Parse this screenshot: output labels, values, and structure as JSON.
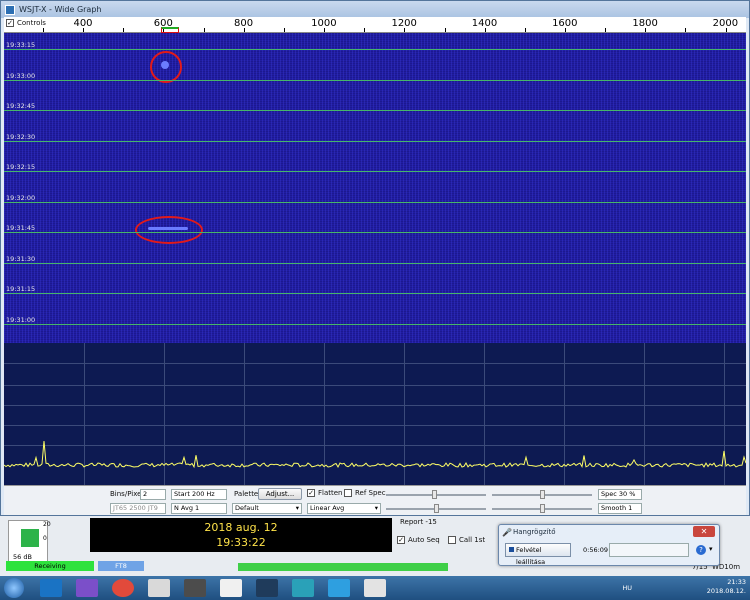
{
  "window": {
    "title": "WSJT-X - Wide Graph"
  },
  "toolbar": {
    "controls_label": "Controls",
    "controls_checked": true,
    "freq_ticks": [
      "400",
      "600",
      "800",
      "1000",
      "1200",
      "1400",
      "1600",
      "1800",
      "2000"
    ]
  },
  "waterfall": {
    "time_labels": [
      "19:33:15",
      "19:33:00",
      "19:32:45",
      "19:32:30",
      "19:32:15",
      "19:32:00",
      "19:31:45",
      "19:31:30",
      "19:31:15",
      "19:31:00"
    ]
  },
  "controls": {
    "bins_label": "Bins/Pixel",
    "bins_value": "2",
    "start_value": "Start 200 Hz",
    "palette_label": "Palette",
    "adjust_button": "Adjust...",
    "flatten_label": "Flatten",
    "flatten_checked": true,
    "refspec_label": "Ref Spec",
    "refspec_checked": false,
    "spec_value": "Spec 30 %",
    "mode_value": "JT65  2500  JT9",
    "navg_value": "N Avg 1",
    "palette_value": "Default",
    "avg_value": "Linear Avg",
    "smooth_value": "Smooth  1"
  },
  "main": {
    "meter_top": "20",
    "meter_zero": "0",
    "meter_db": "56 dB",
    "date": "2018 aug. 12",
    "time": "19:33:22",
    "report": "Report -15",
    "auto_seq_label": "Auto Seq",
    "auto_seq_checked": true,
    "call1st_label": "Call 1st",
    "call1st_checked": false,
    "status_receiving": "Receiving",
    "status_mode": "FT8",
    "seq_count": "7/15",
    "grid": "WD10m"
  },
  "recorder": {
    "title": "Hangrögzítő",
    "stop_button": "Felvétel leállítása",
    "elapsed": "0:56:09"
  },
  "taskbar": {
    "lang": "HU",
    "clock_time": "21:33",
    "clock_date": "2018.08.12."
  }
}
